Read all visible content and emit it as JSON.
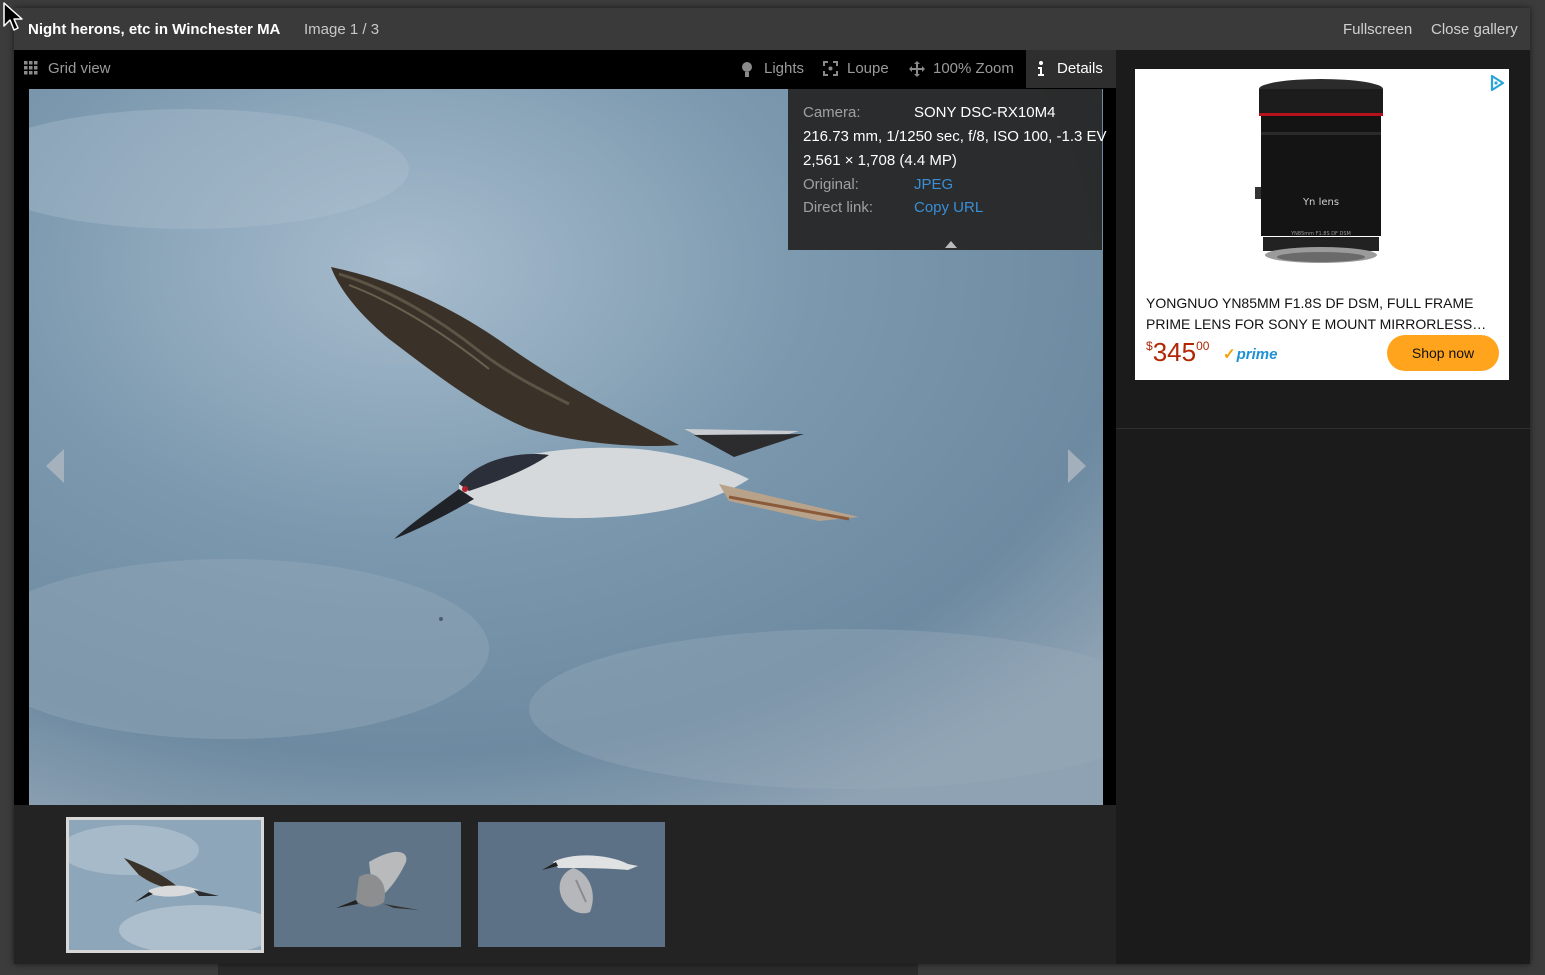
{
  "gallery": {
    "title": "Night herons, etc in Winchester MA",
    "counter": "Image 1 / 3",
    "fullscreen_label": "Fullscreen",
    "close_label": "Close gallery"
  },
  "toolbar": {
    "grid_view_label": "Grid view",
    "lights_label": "Lights",
    "loupe_label": "Loupe",
    "zoom_label": "100% Zoom",
    "details_label": "Details",
    "icons": [
      "grid-icon",
      "bulb-icon",
      "loupe-icon",
      "move-arrows-icon",
      "info-icon"
    ]
  },
  "details": {
    "camera_label": "Camera:",
    "camera_value": "SONY DSC-RX10M4",
    "exposure": "216.73 mm, 1/1250 sec, f/8, ISO 100, -1.3 EV",
    "dimensions": "2,561 × 1,708 (4.4 MP)",
    "original_label": "Original:",
    "original_value": "JPEG",
    "direct_link_label": "Direct link:",
    "direct_link_value": "Copy URL"
  },
  "thumbnails": [
    {
      "selected": true
    },
    {
      "selected": false
    },
    {
      "selected": false
    }
  ],
  "ad": {
    "title_line1": "YONGNUO YN85MM F1.8S DF DSM, FULL FRAME",
    "title_line2": "PRIME LENS FOR SONY E MOUNT MIRRORLESS…",
    "currency": "$",
    "price_whole": "345",
    "price_cents": "00",
    "prime": "prime",
    "shop_label": "Shop now",
    "lens_brand": "Yn lens",
    "lens_model": "YN85mm F1.8S DF DSM"
  },
  "colors": {
    "link": "#3a8fd6",
    "price": "#b12704",
    "shop_button": "#ffa41c",
    "prime": "#1f8fd6"
  }
}
